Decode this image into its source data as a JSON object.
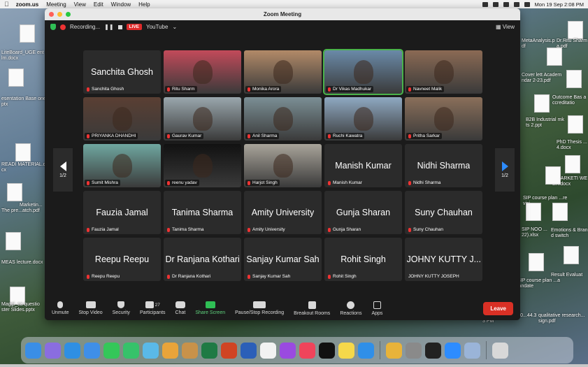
{
  "menubar": {
    "app_name": "zoom.us",
    "items": [
      "Meeting",
      "View",
      "Edit",
      "Window",
      "Help"
    ],
    "clock": "Mon 19 Sep  2:08 PM"
  },
  "desktop": {
    "left_labels": [
      "MetaAnalysis...",
      "LiteBoard_UGE ent Film.docx",
      "esentation Base one.pptx",
      "READI MATERIAL.docx",
      "The pre...atch.pdf",
      "Marketin...",
      "MEAS lecture.docx",
      "Maggi_ca questio ster Slides.pptx"
    ],
    "right_labels": [
      "MetaAnalysis.pdf",
      "Dr.Ritu Sharma.pdf",
      "Cover lett Academ ndar 2-23.pdf",
      "Outcome Bas accreditatio",
      "B2B Industrial mkts 2.ppt",
      "PhD Thesis ...4.docx",
      "3 MARKETI WEEK.docx",
      "SIP course plan ...revisi...",
      "SIP NOO ...22).xlsx",
      "Emotions & Brand switch",
      "Result Evaluat",
      "SIP course plan ...alandate",
      "qualitative research...sign.pdf",
      "screenshot 2022-0...44.33 PM"
    ]
  },
  "zoom": {
    "window_title": "Zoom Meeting",
    "recording_label": "Recording...",
    "live_label": "LIVE",
    "stream_target": "YouTube",
    "view_label": "View",
    "page_indicator": "1/2",
    "participants": [
      {
        "display": "Sanchita Ghosh",
        "label": "Sanchita Ghosh",
        "video": false
      },
      {
        "display": "",
        "label": "Ritu Sharm",
        "video": true,
        "color": "#c24a5a"
      },
      {
        "display": "",
        "label": "Monika Arora",
        "video": true,
        "color": "#b28a68"
      },
      {
        "display": "",
        "label": "Dr Vikas Madhukar",
        "video": true,
        "color": "#6a8aa8",
        "active": true
      },
      {
        "display": "",
        "label": "Navneet Malik",
        "video": true,
        "color": "#8b6a54"
      },
      {
        "display": "",
        "label": "PRIYANKA DHANDHI",
        "video": true,
        "color": "#5a3f33"
      },
      {
        "display": "",
        "label": "Gaurav Kumar",
        "video": true,
        "color": "#9aa7ad"
      },
      {
        "display": "",
        "label": "Anil Sharma",
        "video": true,
        "color": "#7b8f95"
      },
      {
        "display": "",
        "label": "Ruchi Kawatra",
        "video": true,
        "color": "#8fa9c2"
      },
      {
        "display": "",
        "label": "Pritha Sarkar",
        "video": true,
        "color": "#8a6f5a"
      },
      {
        "display": "",
        "label": "Sumit Mishra",
        "video": true,
        "color": "#6fa7a0"
      },
      {
        "display": "",
        "label": "reenu yadav",
        "video": true,
        "color": "#111111"
      },
      {
        "display": "",
        "label": "Harjot Singh",
        "video": true,
        "color": "#a9a49a"
      },
      {
        "display": "Manish Kumar",
        "label": "Manish Kumar",
        "video": false
      },
      {
        "display": "Nidhi Sharma",
        "label": "Nidhi Sharma",
        "video": false
      },
      {
        "display": "Fauzia Jamal",
        "label": "Fauzia Jamal",
        "video": false
      },
      {
        "display": "Tanima Sharma",
        "label": "Tanima Sharma",
        "video": false
      },
      {
        "display": "Amity University",
        "label": "Amity University",
        "video": false
      },
      {
        "display": "Gunja Sharan",
        "label": "Gunja Sharan",
        "video": false
      },
      {
        "display": "Suny Chauhan",
        "label": "Suny Chauhan",
        "video": false
      },
      {
        "display": "Reepu Reepu",
        "label": "Reepu Reepu",
        "video": false
      },
      {
        "display": "Dr Ranjana Kothari",
        "label": "Dr Ranjana Kothari",
        "video": false
      },
      {
        "display": "Sanjay Kumar Sah",
        "label": "Sanjay Kumar Sah",
        "video": false
      },
      {
        "display": "Rohit Singh",
        "label": "Rohit Singh",
        "video": false
      },
      {
        "display": "JOHNY KUTTY J...",
        "label": "JOHNY KUTTY JOSEPH",
        "video": false,
        "unmuted": true
      }
    ],
    "toolbar": {
      "unmute": "Unmute",
      "stop_video": "Stop Video",
      "security": "Security",
      "participants": "Participants",
      "participants_count": "27",
      "chat": "Chat",
      "share_screen": "Share Screen",
      "pause_recording": "Pause/Stop Recording",
      "breakout_rooms": "Breakout Rooms",
      "reactions": "Reactions",
      "apps": "Apps",
      "leave": "Leave"
    }
  },
  "dock": {
    "apps": [
      {
        "icon": "finder-icon",
        "color": "#3a8ee6"
      },
      {
        "icon": "launchpad-icon",
        "color": "#8a6de0"
      },
      {
        "icon": "safari-icon",
        "color": "#2f8fe3"
      },
      {
        "icon": "mail-icon",
        "color": "#3f8fe8"
      },
      {
        "icon": "facetime-icon",
        "color": "#34c759"
      },
      {
        "icon": "messages-icon",
        "color": "#36c26a"
      },
      {
        "icon": "maps-icon",
        "color": "#5ab9e8"
      },
      {
        "icon": "photos-icon",
        "color": "#e8a43a"
      },
      {
        "icon": "contacts-icon",
        "color": "#c8924a"
      },
      {
        "icon": "excel-icon",
        "color": "#1f7a44"
      },
      {
        "icon": "powerpoint-icon",
        "color": "#d04423"
      },
      {
        "icon": "word-icon",
        "color": "#2b5fb8"
      },
      {
        "icon": "reminders-icon",
        "color": "#f2f2f2"
      },
      {
        "icon": "podcasts-icon",
        "color": "#9a4ae0"
      },
      {
        "icon": "music-icon",
        "color": "#f0445b"
      },
      {
        "icon": "tv-icon",
        "color": "#111111"
      },
      {
        "icon": "notes-icon",
        "color": "#f5d84a"
      },
      {
        "icon": "appstore-icon",
        "color": "#2f8fe8"
      },
      {
        "icon": "chrome-icon",
        "color": "#e8b33a"
      },
      {
        "icon": "systemprefs-icon",
        "color": "#8a8a8a"
      },
      {
        "icon": "terminal-icon",
        "color": "#222222"
      },
      {
        "icon": "zoom-icon",
        "color": "#2d8cff"
      },
      {
        "icon": "preview-icon",
        "color": "#9ab4d8"
      },
      {
        "icon": "trash-icon",
        "color": "#d8d8d8"
      }
    ]
  }
}
